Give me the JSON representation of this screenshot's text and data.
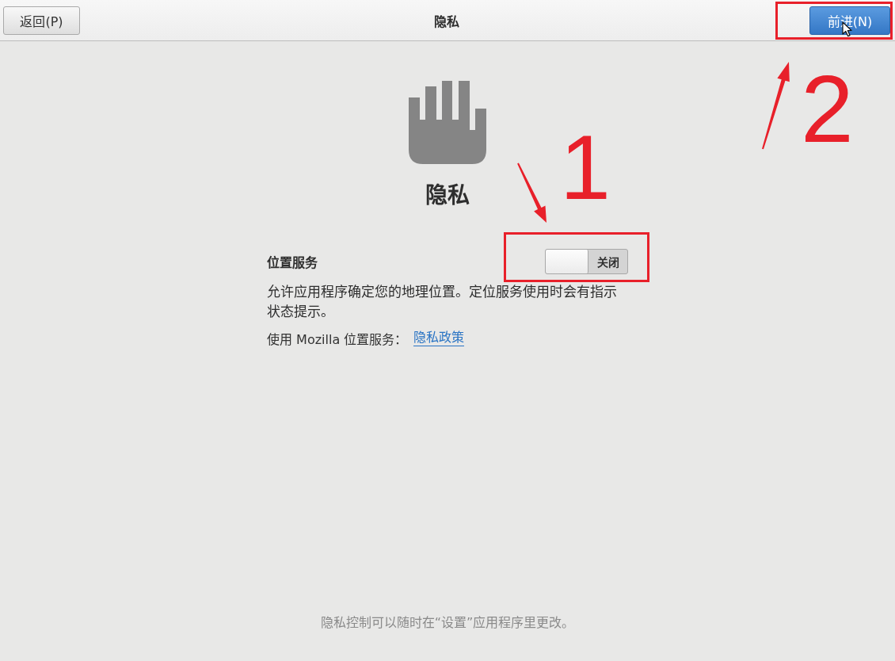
{
  "header": {
    "back_button": "返回(P)",
    "title": "隐私",
    "next_button": "前进(N)"
  },
  "page": {
    "heading": "隐私"
  },
  "location_services": {
    "label": "位置服务",
    "toggle": {
      "on": false,
      "state_label": "关闭"
    },
    "description": "允许应用程序确定您的地理位置。定位服务使用时会有指示状态提示。",
    "mozilla_note": "使用 Mozilla 位置服务：",
    "policy_link": "隐私政策"
  },
  "footer_note": "隐私控制可以随时在“设置”应用程序里更改。",
  "annotations": [
    {
      "kind": "toggle",
      "step": "1"
    },
    {
      "kind": "button",
      "step": "2"
    }
  ]
}
